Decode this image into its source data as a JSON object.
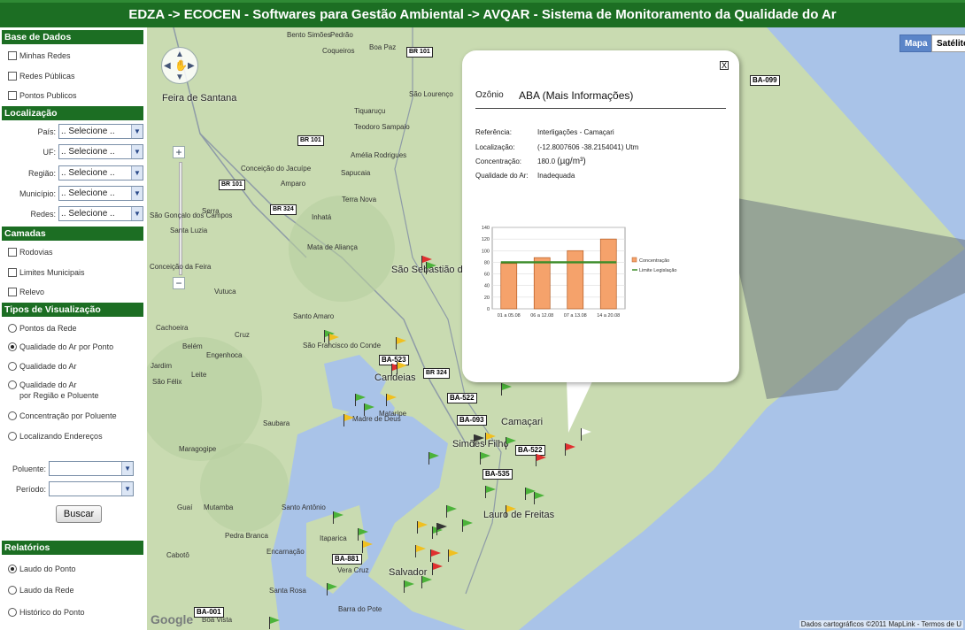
{
  "header": {
    "title": "EDZA -> ECOCEN - Softwares para Gestão Ambiental -> AVQAR - Sistema de Monitoramento da Qualidade do Ar"
  },
  "sidebar": {
    "base_dados": {
      "title": "Base de Dados",
      "items": [
        "Minhas Redes",
        "Redes Públicas",
        "Pontos Publicos"
      ]
    },
    "localizacao": {
      "title": "Localização",
      "fields": [
        {
          "label": "País:",
          "value": ".. Selecione .."
        },
        {
          "label": "UF:",
          "value": ".. Selecione .."
        },
        {
          "label": "Região:",
          "value": ".. Selecione .."
        },
        {
          "label": "Município:",
          "value": ".. Selecione .."
        },
        {
          "label": "Redes:",
          "value": ".. Selecione .."
        }
      ]
    },
    "camadas": {
      "title": "Camadas",
      "items": [
        "Rodovias",
        "Limites Municipais",
        "Relevo"
      ]
    },
    "tipos": {
      "title": "Tipos de Visualização",
      "items": [
        {
          "label": "Pontos da Rede",
          "selected": false
        },
        {
          "label": "Qualidade do Ar por Ponto",
          "selected": true
        },
        {
          "label": "Qualidade do Ar",
          "selected": false
        },
        {
          "label": "Qualidade do Ar",
          "label2": "por Região e Poluente",
          "selected": false
        },
        {
          "label": "Concentração por Poluente",
          "selected": false
        },
        {
          "label": "Localizando Endereços",
          "selected": false
        }
      ]
    },
    "poluente": {
      "label": "Poluente:",
      "value": ""
    },
    "periodo": {
      "label": "Período:",
      "value": ""
    },
    "buscar": "Buscar",
    "relatorios": {
      "title": "Relatórios",
      "items": [
        {
          "label": "Laudo do Ponto",
          "selected": true
        },
        {
          "label": "Laudo da Rede",
          "selected": false
        },
        {
          "label": "Histórico do Ponto",
          "selected": false
        }
      ]
    }
  },
  "map": {
    "type_buttons": [
      "Mapa",
      "Satélite"
    ],
    "credits": "Dados cartográficos ©2011 MapLink - Termos de U",
    "google": "Google",
    "cities": [
      "Feira de Santana",
      "São Sebastião do Passé",
      "Camaçari",
      "Candeias",
      "Simões Filho",
      "Lauro de Freitas",
      "Salvador",
      "Madre de Deus",
      "São Francisco do Conde"
    ],
    "places": [
      "Bento Simões",
      "Pedrão",
      "Coqueiros",
      "Boa Paz",
      "Irará",
      "São Lourenço",
      "Tiquaruçu",
      "Amélia Rodrigues",
      "Conceição do Jacuípe",
      "Amparo",
      "Sapucaia",
      "Teodoro Sampaio",
      "Terra Nova",
      "Inhatá",
      "Serra",
      "Mata de Aliança",
      "São Gonçalo dos Campos",
      "Santo Amaro",
      "Cachoeira",
      "Belém",
      "Engenhoca",
      "Jardim",
      "São Félix",
      "Maragogipe",
      "Saubara",
      "Cruz",
      "Mataripe",
      "Itaparica",
      "Vera Cruz",
      "Barra do Pote",
      "Vutuca",
      "Encarnação",
      "Cabotô",
      "Mutamba",
      "Guaí",
      "Santo Antônio",
      "Leite",
      "Boa Vista",
      "Conceição da Feira",
      "Santa Luzia",
      "Pedra Branca",
      "Santa Rosa"
    ],
    "highways": [
      "BR 101",
      "BR 101",
      "BR 324",
      "BR 101",
      "BR 324",
      "BA-522",
      "BA-093",
      "BA-522",
      "BA-535",
      "BA-881",
      "BA-001",
      "BA-099",
      "BA-523"
    ]
  },
  "popup": {
    "tab": "Ozônio",
    "title": "ABA (Mais Informações)",
    "close": "X",
    "fields": [
      {
        "k": "Referência:",
        "v": "Interligações - Camaçari"
      },
      {
        "k": "Localização:",
        "v": "(-12.8007606 -38.2154041) Utm"
      },
      {
        "k": "Concentração:",
        "v": "180.0",
        "unit": "(µg/m³)"
      },
      {
        "k": "Qualidade do Ar:",
        "v": "Inadequada"
      }
    ]
  },
  "chart_data": {
    "type": "bar",
    "categories": [
      "01 a 05.08",
      "06 a 12.08",
      "07 a 13.08",
      "14 a 20.08"
    ],
    "series": [
      {
        "name": "Concentração",
        "values": [
          78,
          88,
          100,
          120
        ],
        "color": "#f5a26b"
      },
      {
        "name": "Limite Legislação",
        "values": [
          80,
          80,
          80,
          80
        ],
        "color": "#3a8c28"
      }
    ],
    "ylim": [
      0,
      140
    ],
    "yticks": [
      0,
      20,
      40,
      60,
      80,
      100,
      120,
      140
    ],
    "legend": "right"
  }
}
